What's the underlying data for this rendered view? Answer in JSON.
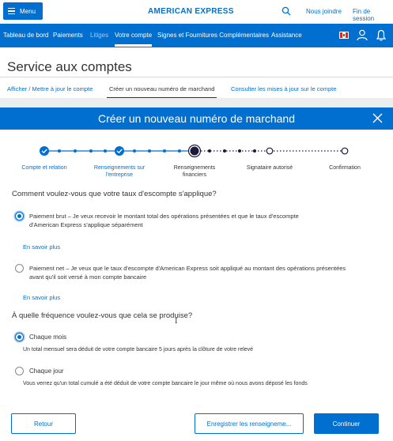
{
  "header": {
    "menu_label": "Menu",
    "brand": "AMERICAN EXPRESS",
    "join_label": "Nous joindre",
    "logout_label": "Fin de session"
  },
  "nav": {
    "items": [
      {
        "label": "Tableau de bord"
      },
      {
        "label": "Paiements"
      },
      {
        "label": "Litiges"
      },
      {
        "label": "Votre compte"
      },
      {
        "label": "Signes et Fournitures Complémentaires"
      },
      {
        "label": "Assistance"
      }
    ]
  },
  "service": {
    "title": "Service aux comptes",
    "tabs": [
      {
        "label": "Afficher / Mettre à jour le compte"
      },
      {
        "label": "Créer un nouveau numéro de marchand"
      },
      {
        "label": "Consulter les mises à jour sur le compte"
      }
    ]
  },
  "modal": {
    "title": "Créer un nouveau numéro de marchand"
  },
  "stepper": {
    "steps": [
      {
        "label_1": "Compte et relation",
        "label_2": "",
        "state": "done"
      },
      {
        "label_1": "Renseignements sur",
        "label_2": "l'entreprise",
        "state": "done"
      },
      {
        "label_1": "Renseignements",
        "label_2": "financiers",
        "state": "current"
      },
      {
        "label_1": "Signataire autorisé",
        "label_2": "",
        "state": "upcoming"
      },
      {
        "label_1": "Confirmation",
        "label_2": "",
        "state": "upcoming"
      }
    ]
  },
  "discount": {
    "question": "Comment voulez-vous que votre taux d'escompte s'applique?",
    "options": [
      {
        "line_1": "Paiement brut – Je veux recevoir le montant total des opérations présentées et que le taux d'escompte",
        "line_2": "d'American Express s'applique séparément",
        "selected": true
      },
      {
        "line_1": "Paiement net – Je veux que le taux d'escompte d'American Express soit appliqué au montant des opérations présentées",
        "line_2": "avant qu'il soit versé à mon compte bancaire",
        "selected": false
      }
    ],
    "learn_more": "En savoir plus"
  },
  "frequency": {
    "question": "À quelle fréquence voulez-vous que cela se produise?",
    "options": [
      {
        "label": "Chaque mois",
        "desc": "Un total mensuel sera déduit de votre compte bancaire 5 jours après la clôture de votre relevé",
        "selected": true
      },
      {
        "label": "Chaque jour",
        "desc": "Vous verrez qu'un total cumulé a été déduit de votre compte bancaire le jour même où nous avons déposé les fonds",
        "selected": false
      }
    ]
  },
  "footer": {
    "back_label": "Retour",
    "save_label": "Enregistrer les renseigneme...",
    "continue_label": "Continuer"
  },
  "colors": {
    "brand_blue": "#006fcf",
    "text": "#333333"
  }
}
